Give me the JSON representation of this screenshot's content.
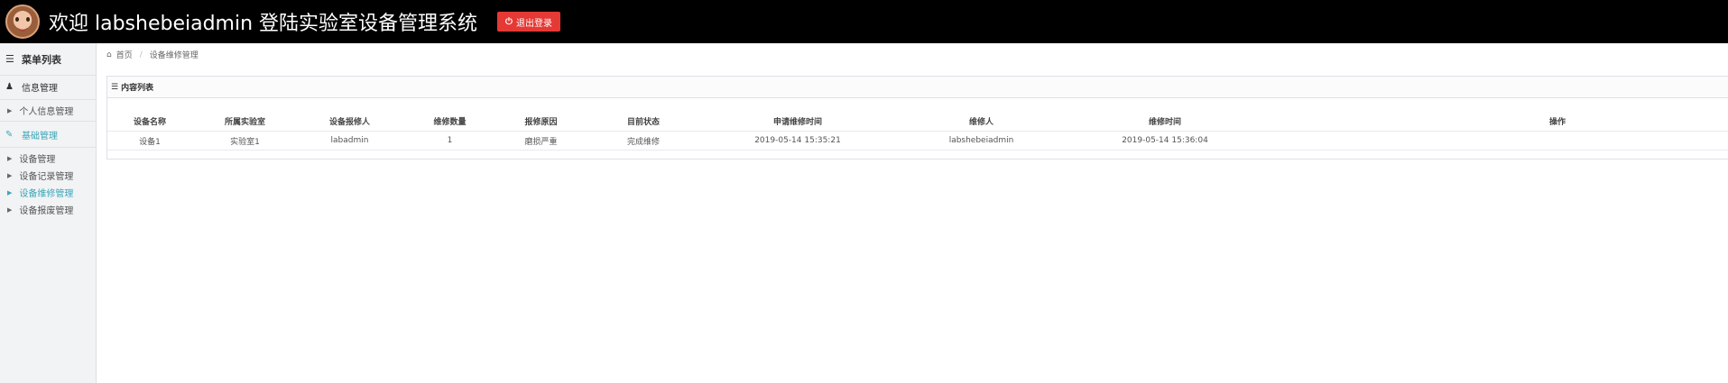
{
  "header": {
    "welcome_text": "欢迎 labshebeiadmin 登陆实验室设备管理系统",
    "logout_label": "退出登录",
    "logout_color": "#e53935"
  },
  "sidebar": {
    "title": "菜单列表",
    "groups": [
      {
        "label": "信息管理",
        "icon": "user-icon",
        "items": [
          {
            "label": "个人信息管理"
          }
        ]
      },
      {
        "label": "基础管理",
        "icon": "edit-icon",
        "items": [
          {
            "label": "设备管理"
          },
          {
            "label": "设备记录管理"
          },
          {
            "label": "设备维修管理"
          },
          {
            "label": "设备报废管理"
          }
        ]
      }
    ],
    "accent_color": "#3aa6b8"
  },
  "breadcrumb": {
    "home": "首页",
    "current": "设备维修管理"
  },
  "panel": {
    "title": "内容列表",
    "columns": [
      "设备名称",
      "所属实验室",
      "设备报修人",
      "维修数量",
      "报修原因",
      "目前状态",
      "申请维修时间",
      "维修人",
      "维修时间",
      "操作"
    ],
    "rows": [
      [
        "设备1",
        "实验室1",
        "labadmin",
        "1",
        "磨损严重",
        "完成维修",
        "2019-05-14 15:35:21",
        "labshebeiadmin",
        "2019-05-14 15:36:04",
        ""
      ]
    ]
  }
}
